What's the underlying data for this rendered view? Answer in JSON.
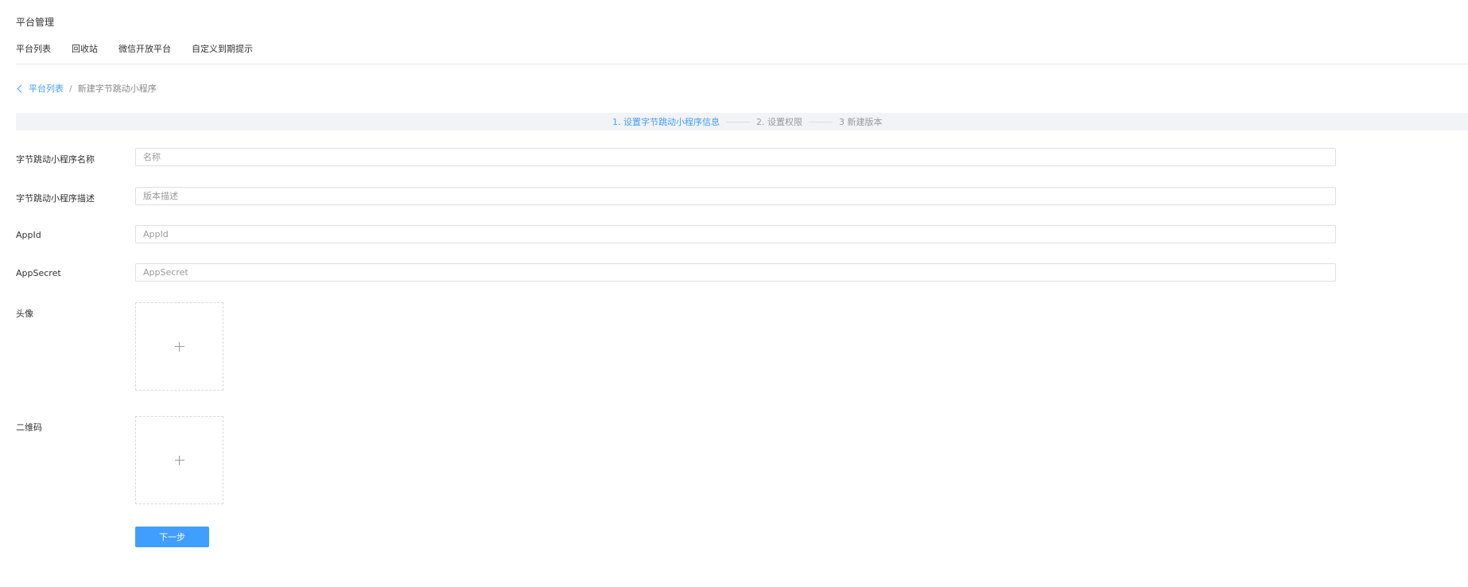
{
  "header": {
    "title": "平台管理",
    "tabs": [
      {
        "label": "平台列表"
      },
      {
        "label": "回收站"
      },
      {
        "label": "微信开放平台"
      },
      {
        "label": "自定义到期提示"
      }
    ]
  },
  "breadcrumb": {
    "back_label": "平台列表",
    "separator": "/",
    "current": "新建字节跳动小程序"
  },
  "steps": [
    {
      "label": "1. 设置字节跳动小程序信息",
      "active": true
    },
    {
      "label": "2. 设置权限",
      "active": false
    },
    {
      "label": "3 新建版本",
      "active": false
    }
  ],
  "form": {
    "name": {
      "label": "字节跳动小程序名称",
      "placeholder": "名称",
      "value": ""
    },
    "description": {
      "label": "字节跳动小程序描述",
      "placeholder": "版本描述",
      "value": ""
    },
    "appid": {
      "label": "AppId",
      "placeholder": "AppId",
      "value": ""
    },
    "appsecret": {
      "label": "AppSecret",
      "placeholder": "AppSecret",
      "value": ""
    },
    "avatar": {
      "label": "头像"
    },
    "qrcode": {
      "label": "二维码"
    }
  },
  "actions": {
    "next_label": "下一步"
  },
  "colors": {
    "accent": "#409eff",
    "steps_background": "#f2f3f7",
    "input_border": "#dcdfe6"
  },
  "icons": {
    "back": "chevron-left-icon",
    "upload": "plus-icon"
  }
}
